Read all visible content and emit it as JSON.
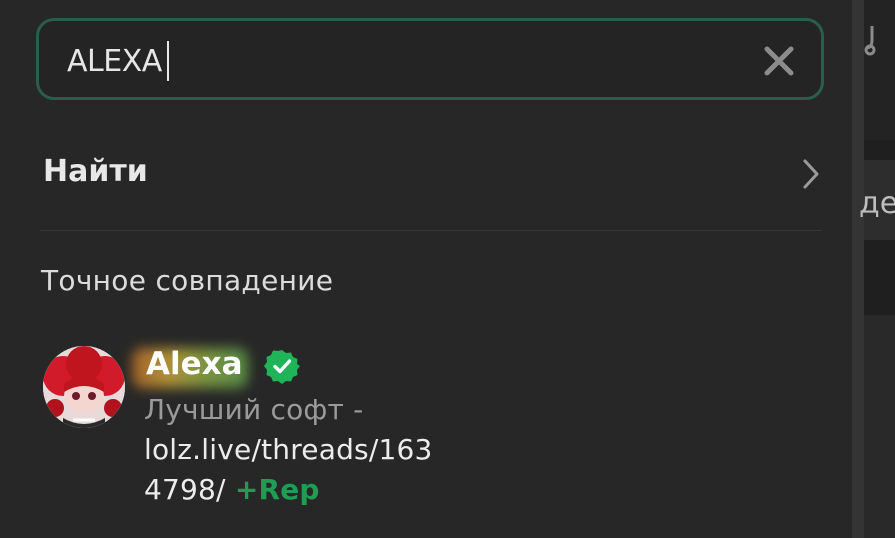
{
  "search": {
    "value": "ALEXA",
    "clear_icon": "close-icon"
  },
  "find": {
    "label": "Найти",
    "icon": "chevron-right-icon"
  },
  "exact_match": {
    "title": "Точное совпадение"
  },
  "result": {
    "username": "Alexa",
    "verified_icon": "verified-check-icon",
    "status_prefix": "Лучший софт -",
    "status_link_line1": "lolz.live/threads/163",
    "status_link_line2": "4798/",
    "rep_label": "+Rep"
  },
  "background_page": {
    "partial_text": "де"
  },
  "colors": {
    "accent_border": "#2a5e4a",
    "verified_green": "#1fb457",
    "rep_green": "#1f9d55"
  }
}
